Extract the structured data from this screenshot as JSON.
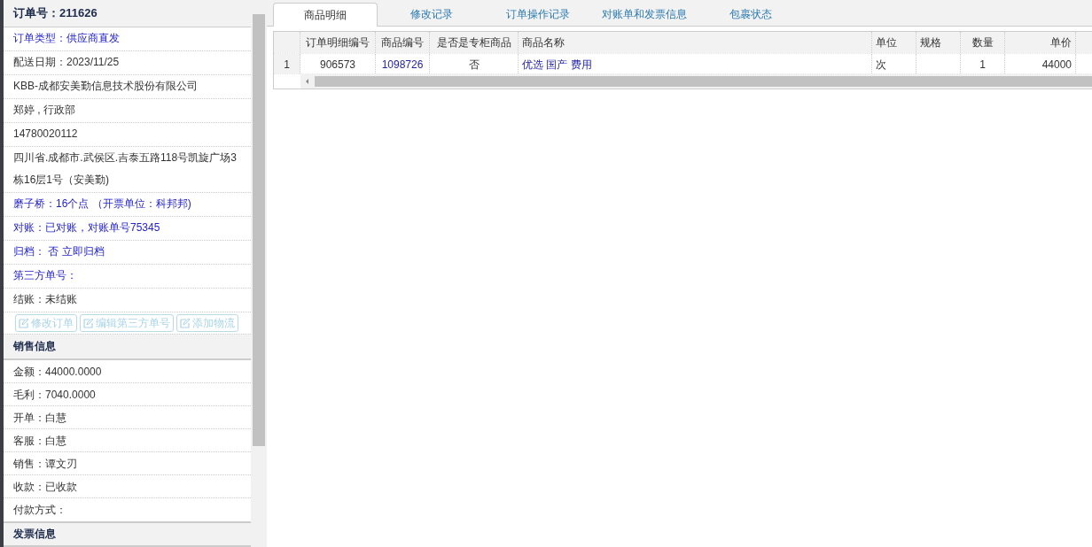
{
  "order_header": "订单号：211626",
  "order_rows": [
    {
      "text": "订单类型：供应商直发",
      "kind": "link"
    },
    {
      "text": "配送日期：2023/11/25",
      "kind": "text"
    },
    {
      "text": "KBB-成都安美勤信息技术股份有限公司",
      "kind": "text"
    },
    {
      "text": "郑婷 , 行政部",
      "kind": "text"
    },
    {
      "text": "14780020112",
      "kind": "text"
    },
    {
      "text": "四川省.成都市.武侯区.吉泰五路118号凯旋广场3栋16层1号（安美勤)",
      "kind": "text"
    },
    {
      "text": "磨子桥：16个点 （开票单位：科邦邦)",
      "kind": "link"
    },
    {
      "text": "对账：已对账，对账单号75345",
      "kind": "link"
    },
    {
      "text": "归档： 否 立即归档",
      "kind": "link"
    },
    {
      "text": "第三方单号：",
      "kind": "link"
    },
    {
      "text": "结账：未结账",
      "kind": "text"
    }
  ],
  "actions": [
    {
      "label": "修改订单",
      "disabled": true
    },
    {
      "label": "编辑第三方单号",
      "disabled": true
    },
    {
      "label": "添加物流",
      "disabled": true
    }
  ],
  "sales_header": "销售信息",
  "sales_rows": [
    "金额：44000.0000",
    "毛利：7040.0000",
    "开单：白慧",
    "客服：白慧",
    "销售：谭文刃",
    "收款：已收款",
    "付款方式："
  ],
  "invoice_header": "发票信息",
  "tabs": [
    {
      "label": "商品明细",
      "selected": true
    },
    {
      "label": "修改记录",
      "selected": false
    },
    {
      "label": "订单操作记录",
      "selected": false
    },
    {
      "label": "对账单和发票信息",
      "selected": false
    },
    {
      "label": "包裹状态",
      "selected": false
    }
  ],
  "table": {
    "columns": [
      "订单明细编号",
      "商品编号",
      "是否是专柜商品",
      "商品名称",
      "单位",
      "规格",
      "数量",
      "单价"
    ],
    "rows": [
      {
        "index": "1",
        "cells": [
          "906573",
          "1098726",
          "否",
          "优选 国产 费用",
          "次",
          "",
          "1",
          "44000"
        ]
      }
    ]
  }
}
